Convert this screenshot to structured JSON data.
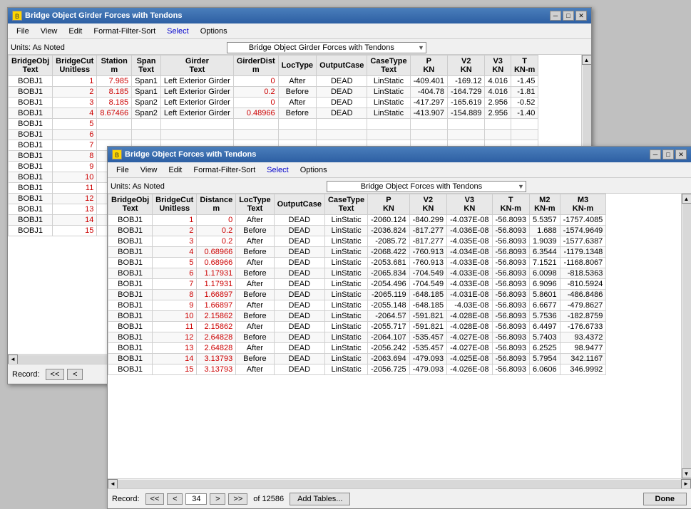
{
  "mainWindow": {
    "title": "Bridge Object Girder Forces with Tendons",
    "icon": "B",
    "menus": [
      "File",
      "View",
      "Edit",
      "Format-Filter-Sort",
      "Select",
      "Options"
    ],
    "selectMenuIndex": 4,
    "units": "Units:  As Noted",
    "dropdownTitle": "Bridge Object Girder Forces with Tendons",
    "columns": [
      {
        "label": "BridgeObj\nText",
        "key": "bridgeObj"
      },
      {
        "label": "BridgeCut\nUnitless",
        "key": "bridgeCut"
      },
      {
        "label": "Station\nm",
        "key": "station"
      },
      {
        "label": "Span\nText",
        "key": "span"
      },
      {
        "label": "Girder\nText",
        "key": "girder"
      },
      {
        "label": "GirderDist\nm",
        "key": "girderDist"
      },
      {
        "label": "LocType\nText",
        "key": "locType"
      },
      {
        "label": "OutputCase",
        "key": "outputCase"
      },
      {
        "label": "CaseType\nText",
        "key": "caseType"
      },
      {
        "label": "P\nKN",
        "key": "p"
      },
      {
        "label": "V2\nKN",
        "key": "v2"
      },
      {
        "label": "V3\nKN",
        "key": "v3"
      },
      {
        "label": "T\nKN-m",
        "key": "t"
      }
    ],
    "rows": [
      {
        "bridgeObj": "BOBJ1",
        "bridgeCut": "1",
        "station": "7.985",
        "span": "Span1",
        "girder": "Left Exterior Girder",
        "girderDist": "0",
        "locType": "After",
        "outputCase": "DEAD",
        "caseType": "LinStatic",
        "p": "-409.401",
        "v2": "-169.12",
        "v3": "4.016",
        "t": "-1.45"
      },
      {
        "bridgeObj": "BOBJ1",
        "bridgeCut": "2",
        "station": "8.185",
        "span": "Span1",
        "girder": "Left Exterior Girder",
        "girderDist": "0.2",
        "locType": "Before",
        "outputCase": "DEAD",
        "caseType": "LinStatic",
        "p": "-404.78",
        "v2": "-164.729",
        "v3": "4.016",
        "t": "-1.81"
      },
      {
        "bridgeObj": "BOBJ1",
        "bridgeCut": "3",
        "station": "8.185",
        "span": "Span2",
        "girder": "Left Exterior Girder",
        "girderDist": "0",
        "locType": "After",
        "outputCase": "DEAD",
        "caseType": "LinStatic",
        "p": "-417.297",
        "v2": "-165.619",
        "v3": "2.956",
        "t": "-0.52"
      },
      {
        "bridgeObj": "BOBJ1",
        "bridgeCut": "4",
        "station": "8.67466",
        "span": "Span2",
        "girder": "Left Exterior Girder",
        "girderDist": "0.48966",
        "locType": "Before",
        "outputCase": "DEAD",
        "caseType": "LinStatic",
        "p": "-413.907",
        "v2": "-154.889",
        "v3": "2.956",
        "t": "-1.40"
      },
      {
        "bridgeObj": "BOBJ1",
        "bridgeCut": "5",
        "station": "",
        "span": "",
        "girder": "",
        "girderDist": "",
        "locType": "",
        "outputCase": "",
        "caseType": "",
        "p": "",
        "v2": "",
        "v3": "",
        "t": ""
      },
      {
        "bridgeObj": "BOBJ1",
        "bridgeCut": "6",
        "station": "",
        "span": "",
        "girder": "",
        "girderDist": "",
        "locType": "",
        "outputCase": "",
        "caseType": "",
        "p": "",
        "v2": "",
        "v3": "",
        "t": ""
      },
      {
        "bridgeObj": "BOBJ1",
        "bridgeCut": "7",
        "station": "",
        "span": "",
        "girder": "",
        "girderDist": "",
        "locType": "",
        "outputCase": "",
        "caseType": "",
        "p": "",
        "v2": "",
        "v3": "",
        "t": ""
      },
      {
        "bridgeObj": "BOBJ1",
        "bridgeCut": "8",
        "station": "",
        "span": "",
        "girder": "",
        "girderDist": "",
        "locType": "",
        "outputCase": "",
        "caseType": "",
        "p": "",
        "v2": "",
        "v3": "",
        "t": ""
      },
      {
        "bridgeObj": "BOBJ1",
        "bridgeCut": "9",
        "station": "",
        "span": "",
        "girder": "",
        "girderDist": "",
        "locType": "",
        "outputCase": "",
        "caseType": "",
        "p": "",
        "v2": "",
        "v3": "",
        "t": ""
      },
      {
        "bridgeObj": "BOBJ1",
        "bridgeCut": "10",
        "station": "",
        "span": "",
        "girder": "",
        "girderDist": "",
        "locType": "",
        "outputCase": "",
        "caseType": "",
        "p": "",
        "v2": "",
        "v3": "",
        "t": ""
      },
      {
        "bridgeObj": "BOBJ1",
        "bridgeCut": "11",
        "station": "",
        "span": "",
        "girder": "",
        "girderDist": "",
        "locType": "",
        "outputCase": "",
        "caseType": "",
        "p": "",
        "v2": "",
        "v3": "",
        "t": ""
      },
      {
        "bridgeObj": "BOBJ1",
        "bridgeCut": "12",
        "station": "",
        "span": "",
        "girder": "",
        "girderDist": "",
        "locType": "",
        "outputCase": "",
        "caseType": "",
        "p": "",
        "v2": "",
        "v3": "",
        "t": ""
      },
      {
        "bridgeObj": "BOBJ1",
        "bridgeCut": "13",
        "station": "",
        "span": "",
        "girder": "",
        "girderDist": "",
        "locType": "",
        "outputCase": "",
        "caseType": "",
        "p": "",
        "v2": "",
        "v3": "",
        "t": ""
      },
      {
        "bridgeObj": "BOBJ1",
        "bridgeCut": "14",
        "station": "",
        "span": "",
        "girder": "",
        "girderDist": "",
        "locType": "",
        "outputCase": "",
        "caseType": "",
        "p": "",
        "v2": "",
        "v3": "",
        "t": ""
      },
      {
        "bridgeObj": "BOBJ1",
        "bridgeCut": "15",
        "station": "",
        "span": "",
        "girder": "",
        "girderDist": "",
        "locType": "",
        "outputCase": "",
        "caseType": "",
        "p": "",
        "v2": "",
        "v3": "",
        "t": ""
      }
    ],
    "record": {
      "label": "Record:",
      "first": "<<",
      "prev": "<",
      "current": "",
      "next": "",
      "last": ""
    }
  },
  "innerWindow": {
    "title": "Bridge Object Forces with Tendons",
    "icon": "B",
    "menus": [
      "File",
      "View",
      "Edit",
      "Format-Filter-Sort",
      "Select",
      "Options"
    ],
    "selectMenuIndex": 4,
    "units": "Units:  As Noted",
    "dropdownTitle": "Bridge Object Forces with Tendons",
    "columns": [
      {
        "label": "BridgeObj\nText",
        "key": "bridgeObj"
      },
      {
        "label": "BridgeCut\nUnitless",
        "key": "bridgeCut"
      },
      {
        "label": "Distance\nm",
        "key": "distance"
      },
      {
        "label": "LocType\nText",
        "key": "locType"
      },
      {
        "label": "OutputCase",
        "key": "outputCase"
      },
      {
        "label": "CaseType\nText",
        "key": "caseType"
      },
      {
        "label": "P\nKN",
        "key": "p"
      },
      {
        "label": "V2\nKN",
        "key": "v2"
      },
      {
        "label": "V3\nKN",
        "key": "v3"
      },
      {
        "label": "T\nKN-m",
        "key": "t"
      },
      {
        "label": "M2\nKN-m",
        "key": "m2"
      },
      {
        "label": "M3\nKN-m",
        "key": "m3"
      }
    ],
    "rows": [
      {
        "bridgeObj": "BOBJ1",
        "bridgeCut": "1",
        "distance": "0",
        "locType": "After",
        "outputCase": "DEAD",
        "caseType": "LinStatic",
        "p": "-2060.124",
        "v2": "-840.299",
        "v3": "-4.037E-08",
        "t": "-56.8093",
        "m2": "5.5357",
        "m3": "-1757.4085"
      },
      {
        "bridgeObj": "BOBJ1",
        "bridgeCut": "2",
        "distance": "0.2",
        "locType": "Before",
        "outputCase": "DEAD",
        "caseType": "LinStatic",
        "p": "-2036.824",
        "v2": "-817.277",
        "v3": "-4.036E-08",
        "t": "-56.8093",
        "m2": "1.688",
        "m3": "-1574.9649"
      },
      {
        "bridgeObj": "BOBJ1",
        "bridgeCut": "3",
        "distance": "0.2",
        "locType": "After",
        "outputCase": "DEAD",
        "caseType": "LinStatic",
        "p": "-2085.72",
        "v2": "-817.277",
        "v3": "-4.035E-08",
        "t": "-56.8093",
        "m2": "1.9039",
        "m3": "-1577.6387"
      },
      {
        "bridgeObj": "BOBJ1",
        "bridgeCut": "4",
        "distance": "0.68966",
        "locType": "Before",
        "outputCase": "DEAD",
        "caseType": "LinStatic",
        "p": "-2068.422",
        "v2": "-760.913",
        "v3": "-4.034E-08",
        "t": "-56.8093",
        "m2": "6.3544",
        "m3": "-1179.1348"
      },
      {
        "bridgeObj": "BOBJ1",
        "bridgeCut": "5",
        "distance": "0.68966",
        "locType": "After",
        "outputCase": "DEAD",
        "caseType": "LinStatic",
        "p": "-2053.681",
        "v2": "-760.913",
        "v3": "-4.033E-08",
        "t": "-56.8093",
        "m2": "7.1521",
        "m3": "-1168.8067"
      },
      {
        "bridgeObj": "BOBJ1",
        "bridgeCut": "6",
        "distance": "1.17931",
        "locType": "Before",
        "outputCase": "DEAD",
        "caseType": "LinStatic",
        "p": "-2065.834",
        "v2": "-704.549",
        "v3": "-4.033E-08",
        "t": "-56.8093",
        "m2": "6.0098",
        "m3": "-818.5363"
      },
      {
        "bridgeObj": "BOBJ1",
        "bridgeCut": "7",
        "distance": "1.17931",
        "locType": "After",
        "outputCase": "DEAD",
        "caseType": "LinStatic",
        "p": "-2054.496",
        "v2": "-704.549",
        "v3": "-4.033E-08",
        "t": "-56.8093",
        "m2": "6.9096",
        "m3": "-810.5924"
      },
      {
        "bridgeObj": "BOBJ1",
        "bridgeCut": "8",
        "distance": "1.66897",
        "locType": "Before",
        "outputCase": "DEAD",
        "caseType": "LinStatic",
        "p": "-2065.119",
        "v2": "-648.185",
        "v3": "-4.031E-08",
        "t": "-56.8093",
        "m2": "5.8601",
        "m3": "-486.8486"
      },
      {
        "bridgeObj": "BOBJ1",
        "bridgeCut": "9",
        "distance": "1.66897",
        "locType": "After",
        "outputCase": "DEAD",
        "caseType": "LinStatic",
        "p": "-2055.148",
        "v2": "-648.185",
        "v3": "-4.03E-08",
        "t": "-56.8093",
        "m2": "6.6677",
        "m3": "-479.8627"
      },
      {
        "bridgeObj": "BOBJ1",
        "bridgeCut": "10",
        "distance": "2.15862",
        "locType": "Before",
        "outputCase": "DEAD",
        "caseType": "LinStatic",
        "p": "-2064.57",
        "v2": "-591.821",
        "v3": "-4.028E-08",
        "t": "-56.8093",
        "m2": "5.7536",
        "m3": "-182.8759"
      },
      {
        "bridgeObj": "BOBJ1",
        "bridgeCut": "11",
        "distance": "2.15862",
        "locType": "After",
        "outputCase": "DEAD",
        "caseType": "LinStatic",
        "p": "-2055.717",
        "v2": "-591.821",
        "v3": "-4.028E-08",
        "t": "-56.8093",
        "m2": "6.4497",
        "m3": "-176.6733"
      },
      {
        "bridgeObj": "BOBJ1",
        "bridgeCut": "12",
        "distance": "2.64828",
        "locType": "Before",
        "outputCase": "DEAD",
        "caseType": "LinStatic",
        "p": "-2064.107",
        "v2": "-535.457",
        "v3": "-4.027E-08",
        "t": "-56.8093",
        "m2": "5.7403",
        "m3": "93.4372"
      },
      {
        "bridgeObj": "BOBJ1",
        "bridgeCut": "13",
        "distance": "2.64828",
        "locType": "After",
        "outputCase": "DEAD",
        "caseType": "LinStatic",
        "p": "-2056.242",
        "v2": "-535.457",
        "v3": "-4.027E-08",
        "t": "-56.8093",
        "m2": "6.2525",
        "m3": "98.9477"
      },
      {
        "bridgeObj": "BOBJ1",
        "bridgeCut": "14",
        "distance": "3.13793",
        "locType": "Before",
        "outputCase": "DEAD",
        "caseType": "LinStatic",
        "p": "-2063.694",
        "v2": "-479.093",
        "v3": "-4.025E-08",
        "t": "-56.8093",
        "m2": "5.7954",
        "m3": "342.1167"
      },
      {
        "bridgeObj": "BOBJ1",
        "bridgeCut": "15",
        "distance": "3.13793",
        "locType": "After",
        "outputCase": "DEAD",
        "caseType": "LinStatic",
        "p": "-2056.725",
        "v2": "-479.093",
        "v3": "-4.026E-08",
        "t": "-56.8093",
        "m2": "6.0606",
        "m3": "346.9992"
      }
    ],
    "record": {
      "label": "Record:",
      "first": "<<",
      "prev": "<",
      "current": "34",
      "next": ">",
      "last": ">>",
      "total": "of 12586",
      "addTablesBtn": "Add Tables...",
      "doneBtn": "Done"
    }
  }
}
